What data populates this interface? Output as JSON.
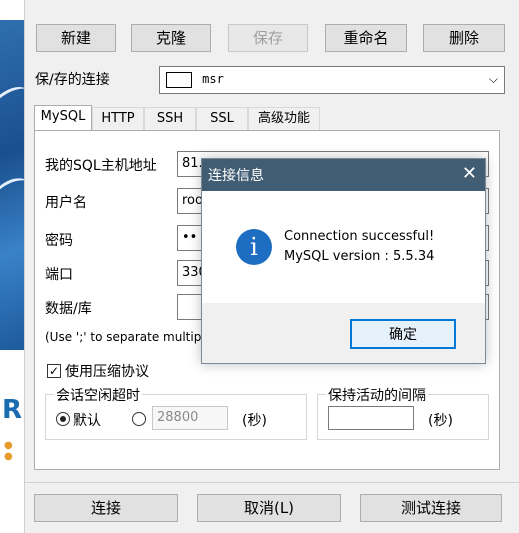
{
  "toolbar": {
    "new_label": "新建",
    "clone_label": "克隆",
    "save_label": "保存",
    "rename_label": "重命名",
    "delete_label": "删除"
  },
  "saved_connection": {
    "label": "保/存的连接",
    "value": "msr"
  },
  "tabs": [
    {
      "label": "MySQL",
      "active": true
    },
    {
      "label": "HTTP"
    },
    {
      "label": "SSH"
    },
    {
      "label": "SSL"
    },
    {
      "label": "高级功能"
    }
  ],
  "form": {
    "host_label": "我的SQL主机地址",
    "host_value": "81.",
    "user_label": "用户名",
    "user_value": "roo",
    "password_label": "密码",
    "password_value": "••",
    "port_label": "端口",
    "port_value": "330",
    "database_label": "数据/库",
    "database_value": "",
    "hint": "(Use ';' to separate multipl",
    "compress_label": "使用压缩协议",
    "compress_checked": true,
    "idle_group_title": "会话空闲超时",
    "idle_default_label": "默认",
    "idle_value": "28800",
    "idle_unit": "(秒)",
    "keepalive_group_title": "保持活动的间隔",
    "keepalive_value": "",
    "keepalive_unit": "(秒)"
  },
  "bottom": {
    "connect_label": "连接",
    "cancel_label": "取消(L)",
    "test_label": "测试连接"
  },
  "message_box": {
    "title": "连接信息",
    "close_glyph": "✕",
    "line1": "Connection successful!",
    "line2": "MySQL version : 5.5.34",
    "ok_label": "确定",
    "icon_glyph": "i"
  },
  "colors": {
    "titlebar": "#415d74",
    "info_icon": "#1d6ec2",
    "focus_border": "#0078d7"
  }
}
